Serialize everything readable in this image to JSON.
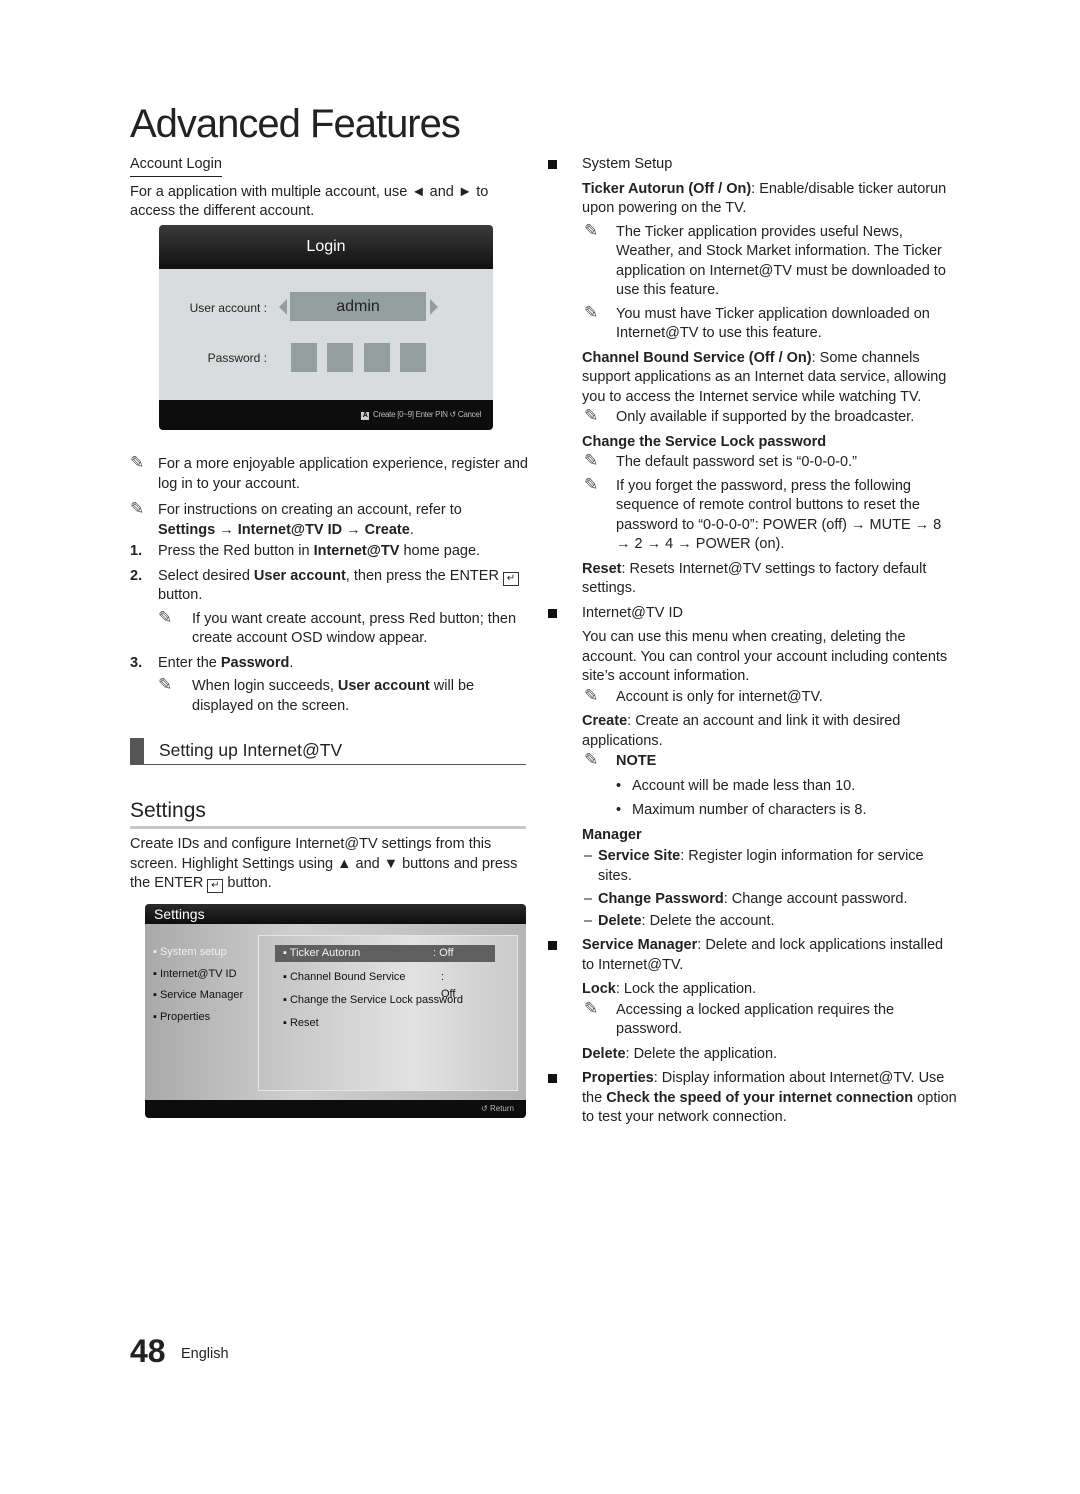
{
  "page": {
    "title": "Advanced Features",
    "number": "48",
    "language": "English"
  },
  "account_login": {
    "heading": "Account Login",
    "intro": "For a application with multiple account, use ◄ and ► to access the different account.",
    "osd": {
      "title": "Login",
      "user_account_label": "User account :",
      "user_account_value": "admin",
      "password_label": "Password :",
      "pin_boxes": 4,
      "footer_a_key": "A",
      "footer_create": "Create",
      "footer_enter_pin": "[0~9] Enter PIN",
      "footer_cancel": "Cancel"
    },
    "notes": [
      "For a more enjoyable application experience, register and log in to your account.",
      "For instructions on creating an account, refer to"
    ],
    "note2_path": "Settings → Internet@TV ID → Create",
    "steps": [
      {
        "n": "1.",
        "pre": "Press the Red button in ",
        "bold": "Internet@TV",
        "post": " home page."
      },
      {
        "n": "2.",
        "pre": "Select desired ",
        "bold": "User account",
        "post": ", then press the ENTER",
        "post2": " button."
      },
      {
        "n": "3.",
        "pre": "Enter the ",
        "bold": "Password",
        "post": "."
      }
    ],
    "step2_note": "If you want create account, press Red button; then create account OSD window appear.",
    "step3_note_pre": "When login succeeds, ",
    "step3_note_bold": "User account",
    "step3_note_post": " will be displayed on the screen."
  },
  "section": {
    "heading": "Setting up Internet@TV"
  },
  "settings": {
    "heading": "Settings",
    "desc_line1": "Create IDs and configure Internet@TV settings from this screen. Highlight Settings using ▲ and ▼ buttons and press the ",
    "desc_enter": "ENTER",
    "desc_end": " button.",
    "osd": {
      "title": "Settings",
      "left_menu": [
        "System setup",
        "Internet@TV ID",
        "Service Manager",
        "Properties"
      ],
      "active_index": 0,
      "rows": [
        {
          "label": "Ticker Autorun",
          "value": ": Off",
          "highlighted": true
        },
        {
          "label": "Channel Bound Service",
          "value": ": Off"
        },
        {
          "label": "Change the Service Lock password",
          "value": ""
        },
        {
          "label": "Reset",
          "value": ""
        }
      ],
      "footer_return": "Return"
    }
  },
  "right": {
    "system_setup": {
      "heading": "System Setup",
      "ticker_bold": "Ticker Autorun (Off / On)",
      "ticker_text": ": Enable/disable ticker autorun upon powering on the TV.",
      "ticker_note1": "The Ticker application provides useful News, Weather, and Stock Market information. The Ticker application on Internet@TV must be downloaded to use this feature.",
      "ticker_note2": "You must have Ticker application downloaded on Internet@TV to use this feature.",
      "cbs_bold": "Channel Bound Service (Off / On)",
      "cbs_text": ": Some channels support applications as an Internet data service, allowing you to access the Internet service while watching TV.",
      "cbs_note": "Only available if supported by the broadcaster.",
      "lock_heading": "Change the Service Lock password",
      "lock_note1": "The default password set is “0-0-0-0.”",
      "lock_note2": "If you forget the password, press the following sequence of remote control buttons to reset the password to “0-0-0-0”: POWER (off) → MUTE → 8 → 2 → 4 → POWER (on).",
      "reset_bold": "Reset",
      "reset_text": ": Resets Internet@TV settings to factory default settings."
    },
    "internet_id": {
      "heading": "Internet@TV ID",
      "desc": "You can use this menu when creating, deleting the account. You can control your account including contents site’s account information.",
      "note": "Account is only for internet@TV.",
      "create_bold": "Create",
      "create_text": ": Create an account and link it with desired applications.",
      "note_heading": "NOTE",
      "bullets": [
        "Account will be made less than 10.",
        "Maximum number of characters is 8."
      ],
      "manager_heading": "Manager",
      "manager_items": [
        {
          "bold": "Service Site",
          "text": ": Register login information for service sites."
        },
        {
          "bold": "Change Password",
          "text": ": Change account password."
        },
        {
          "bold": "Delete",
          "text": ": Delete the account."
        }
      ]
    },
    "service_manager": {
      "bold": "Service Manager",
      "text": ": Delete and lock applications installed to Internet@TV.",
      "lock_bold": "Lock",
      "lock_text": ": Lock the application.",
      "lock_note": "Accessing a locked application requires the password.",
      "delete_bold": "Delete",
      "delete_text": ": Delete the application."
    },
    "properties": {
      "bold": "Properties",
      "text1": ": Display information about Internet@TV. Use the ",
      "bold2": "Check the speed of your internet connection",
      "text2": " option to test your network connection."
    }
  }
}
